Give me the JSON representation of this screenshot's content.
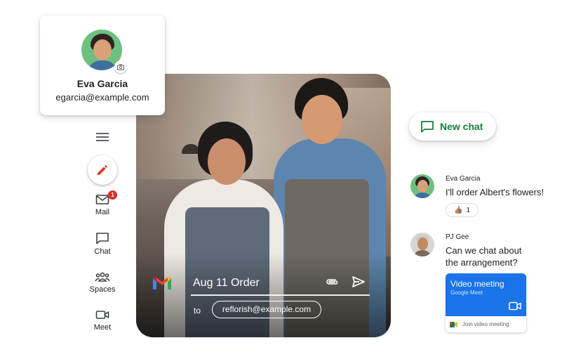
{
  "profile": {
    "name": "Eva Garcia",
    "email": "egarcia@example.com"
  },
  "nav": {
    "items": [
      {
        "label": "Mail",
        "icon": "mail-icon",
        "badge": "1"
      },
      {
        "label": "Chat",
        "icon": "chat-icon"
      },
      {
        "label": "Spaces",
        "icon": "spaces-icon"
      },
      {
        "label": "Meet",
        "icon": "meet-icon"
      }
    ]
  },
  "compose": {
    "subject": "Aug 11 Order",
    "to_label": "to",
    "recipient": "reflorish@example.com"
  },
  "chat": {
    "new_chat_label": "New chat",
    "messages": [
      {
        "sender": "Eva Garcia",
        "text": "I'll order Albert's flowers!",
        "reaction": {
          "emoji": "👍🏽",
          "count": "1"
        }
      },
      {
        "sender": "PJ Gee",
        "text_line1": "Can we chat about",
        "text_line2": "the arrangement?"
      }
    ],
    "meet_card": {
      "title": "Video meeting",
      "subtitle": "Google Meet",
      "join_label": "Join video meeting"
    }
  },
  "colors": {
    "accent_green": "#188038",
    "meet_blue": "#1a73e8",
    "badge_red": "#d93025"
  }
}
